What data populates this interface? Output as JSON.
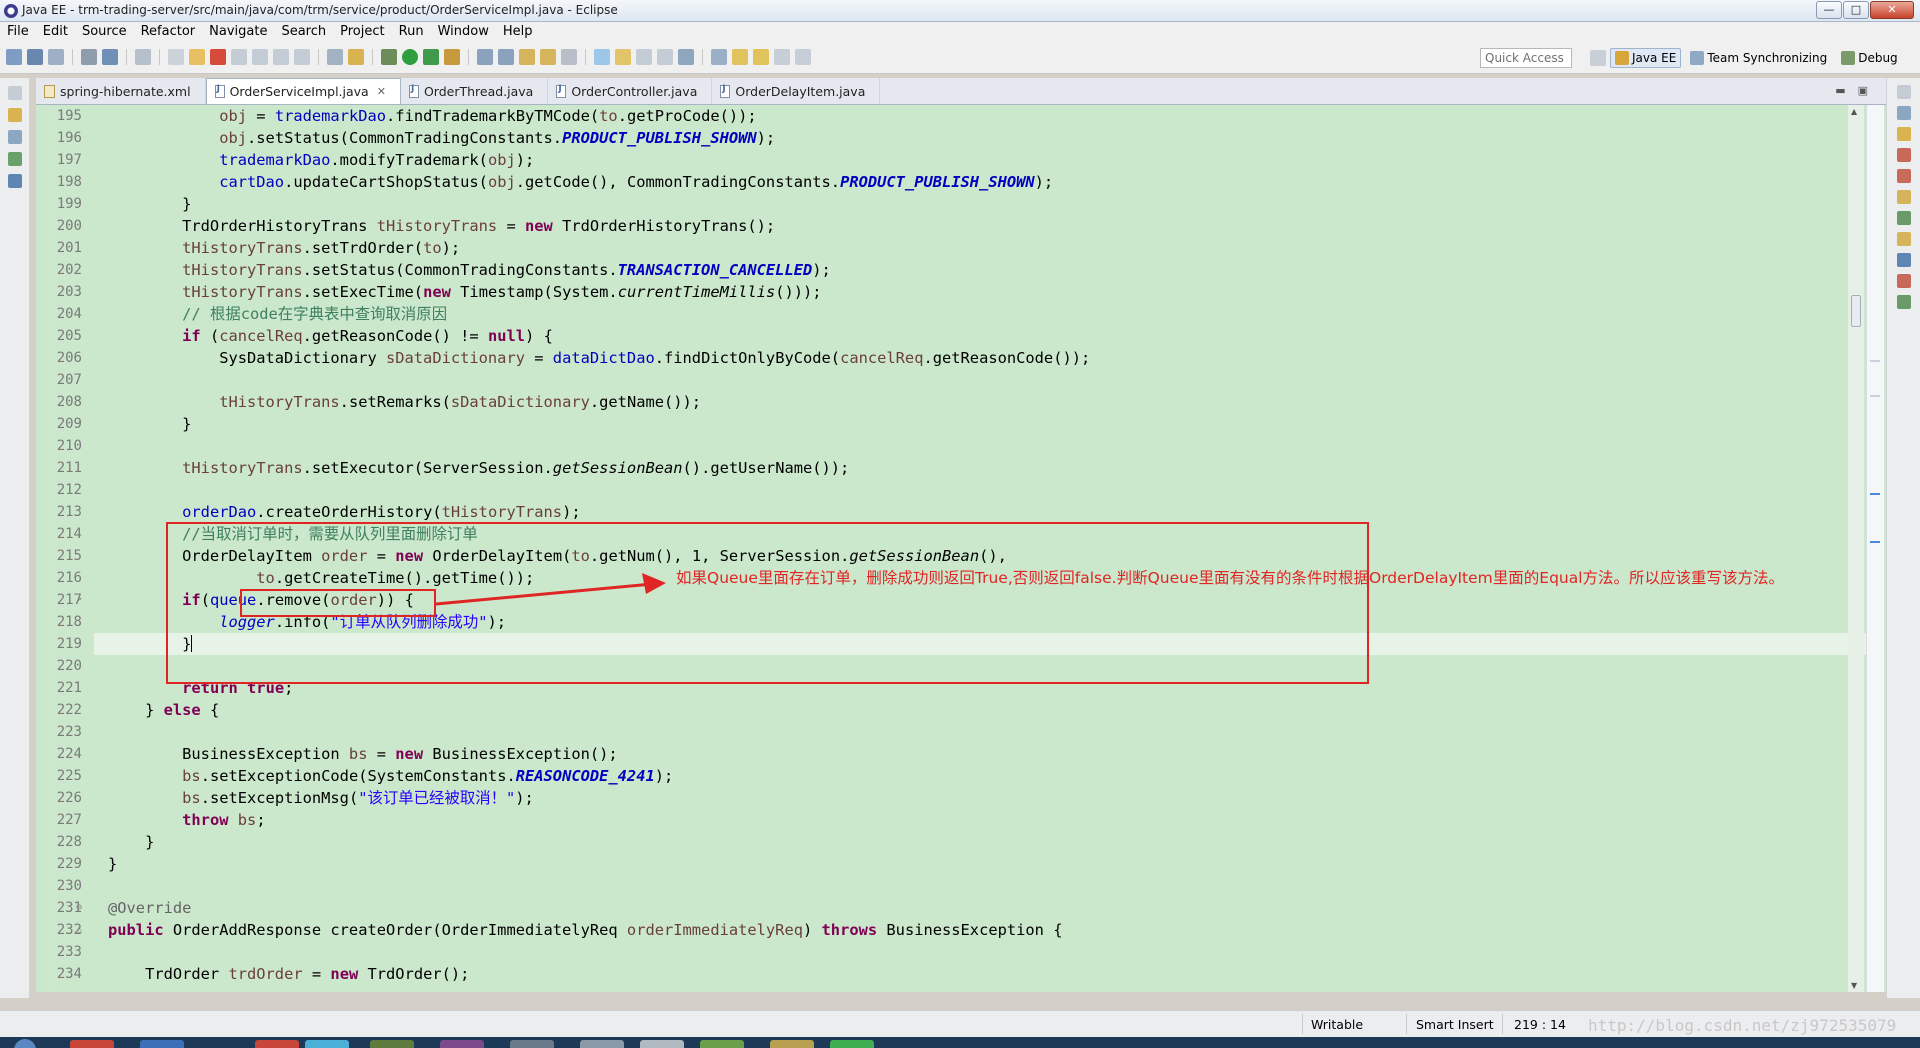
{
  "window": {
    "title": "Java EE - trm-trading-server/src/main/java/com/trm/service/product/OrderServiceImpl.java - Eclipse",
    "buttons": {
      "minimize": "—",
      "maximize": "□",
      "close": "✕"
    }
  },
  "menubar": [
    "File",
    "Edit",
    "Source",
    "Refactor",
    "Navigate",
    "Search",
    "Project",
    "Run",
    "Window",
    "Help"
  ],
  "toolbar": {
    "quick_access_placeholder": "Quick Access",
    "perspectives": [
      "Java EE",
      "Team Synchronizing",
      "Debug"
    ]
  },
  "editor_tabs": [
    {
      "label": "spring-hibernate.xml",
      "icon": "xml-file-icon",
      "active": false
    },
    {
      "label": "OrderServiceImpl.java",
      "icon": "java-file-icon",
      "active": true
    },
    {
      "label": "OrderThread.java",
      "icon": "java-file-icon",
      "active": false
    },
    {
      "label": "OrderController.java",
      "icon": "java-file-icon",
      "active": false
    },
    {
      "label": "OrderDelayItem.java",
      "icon": "java-file-icon",
      "active": false
    }
  ],
  "editor": {
    "current_line": 219,
    "lines": [
      {
        "n": "195",
        "code": "            obj = trademarkDao.findTrademarkByTMCode(to.getProCode());"
      },
      {
        "n": "196",
        "code": "            obj.setStatus(CommonTradingConstants.PRODUCT_PUBLISH_SHOWN);"
      },
      {
        "n": "197",
        "code": "            trademarkDao.modifyTrademark(obj);"
      },
      {
        "n": "198",
        "code": "            cartDao.updateCartShopStatus(obj.getCode(), CommonTradingConstants.PRODUCT_PUBLISH_SHOWN);"
      },
      {
        "n": "199",
        "code": "        }"
      },
      {
        "n": "200",
        "code": "        TrdOrderHistoryTrans tHistoryTrans = new TrdOrderHistoryTrans();"
      },
      {
        "n": "201",
        "code": "        tHistoryTrans.setTrdOrder(to);"
      },
      {
        "n": "202",
        "code": "        tHistoryTrans.setStatus(CommonTradingConstants.TRANSACTION_CANCELLED);"
      },
      {
        "n": "203",
        "code": "        tHistoryTrans.setExecTime(new Timestamp(System.currentTimeMillis()));"
      },
      {
        "n": "204",
        "code": "        // 根据code在字典表中查询取消原因"
      },
      {
        "n": "205",
        "code": "        if (cancelReq.getReasonCode() != null) {"
      },
      {
        "n": "206",
        "code": "            SysDataDictionary sDataDictionary = dataDictDao.findDictOnlyByCode(cancelReq.getReasonCode());"
      },
      {
        "n": "207",
        "code": ""
      },
      {
        "n": "208",
        "code": "            tHistoryTrans.setRemarks(sDataDictionary.getName());"
      },
      {
        "n": "209",
        "code": "        }"
      },
      {
        "n": "210",
        "code": ""
      },
      {
        "n": "211",
        "code": "        tHistoryTrans.setExecutor(ServerSession.getSessionBean().getUserName());"
      },
      {
        "n": "212",
        "code": ""
      },
      {
        "n": "213",
        "code": "        orderDao.createOrderHistory(tHistoryTrans);"
      },
      {
        "n": "214",
        "code": "        //当取消订单时，需要从队列里面删除订单"
      },
      {
        "n": "215",
        "code": "        OrderDelayItem order = new OrderDelayItem(to.getNum(), 1, ServerSession.getSessionBean(),"
      },
      {
        "n": "216",
        "code": "                to.getCreateTime().getTime());"
      },
      {
        "n": "217",
        "code": "        if(queue.remove(order)) {"
      },
      {
        "n": "218",
        "code": "            logger.info(\"订单从队列删除成功\");"
      },
      {
        "n": "219",
        "code": "        }"
      },
      {
        "n": "220",
        "code": ""
      },
      {
        "n": "221",
        "code": "        return true;"
      },
      {
        "n": "222",
        "code": "    } else {"
      },
      {
        "n": "223",
        "code": ""
      },
      {
        "n": "224",
        "code": "        BusinessException bs = new BusinessException();"
      },
      {
        "n": "225",
        "code": "        bs.setExceptionCode(SystemConstants.REASONCODE_4241);"
      },
      {
        "n": "226",
        "code": "        bs.setExceptionMsg(\"该订单已经被取消！\");"
      },
      {
        "n": "227",
        "code": "        throw bs;"
      },
      {
        "n": "228",
        "code": "    }"
      },
      {
        "n": "229",
        "code": "}"
      },
      {
        "n": "230",
        "code": ""
      },
      {
        "n": "231",
        "code": "@Override"
      },
      {
        "n": "232",
        "code": "public OrderAddResponse createOrder(OrderImmediatelyReq orderImmediatelyReq) throws BusinessException {"
      },
      {
        "n": "233",
        "code": ""
      },
      {
        "n": "234",
        "code": "    TrdOrder trdOrder = new TrdOrder();"
      }
    ]
  },
  "annotation": {
    "text": "如果Queue里面存在订单，删除成功则返回True,否则返回false.判断Queue里面有没有的条件时根据OrderDelayItem里面的Equal方法。所以应该重写该方法。",
    "color": "#e02525"
  },
  "statusbar": {
    "writable": "Writable",
    "insert_mode": "Smart Insert",
    "position": "219 : 14",
    "watermark": "http://blog.csdn.net/zj972535079"
  },
  "colors": {
    "editor_background": "#cbe8cc",
    "keyword": "#7f0055",
    "field": "#0000c0",
    "comment": "#3f7f5f",
    "string": "#2a00ff"
  }
}
